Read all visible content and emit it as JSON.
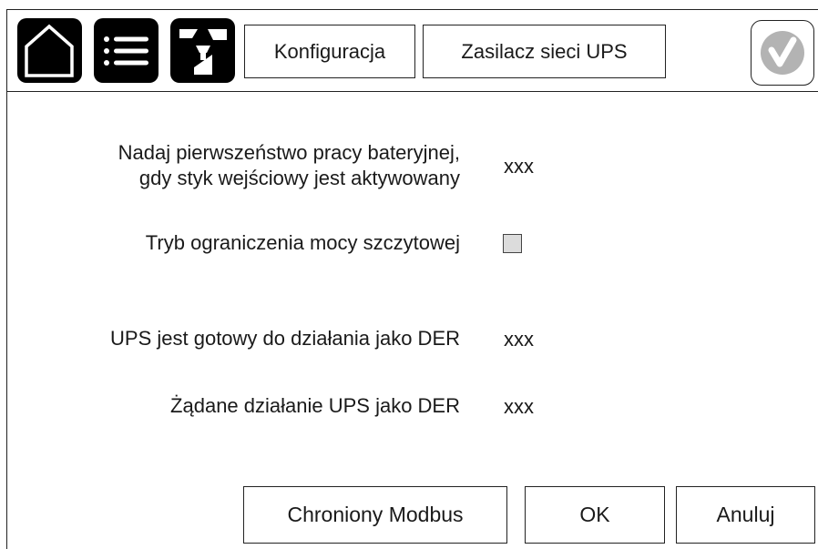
{
  "header": {
    "icons": [
      "home-icon",
      "menu-list-icon",
      "tools-icon"
    ],
    "tabs": [
      {
        "label": "Konfiguracja"
      },
      {
        "label": "Zasilacz sieci UPS"
      }
    ],
    "status_icon": "checkmark-icon"
  },
  "settings": {
    "rows": [
      {
        "label_line1": "Nadaj pierwszeństwo pracy bateryjnej,",
        "label_line2": "gdy styk wejściowy jest aktywowany",
        "value": "xxx"
      },
      {
        "label": "Tryb ograniczenia mocy szczytowej",
        "checked": false
      },
      {
        "label": "UPS jest gotowy do działania jako DER",
        "value": "xxx"
      },
      {
        "label": "Żądane działanie UPS jako DER",
        "value": "xxx"
      }
    ]
  },
  "footer": {
    "modbus_label": "Chroniony Modbus",
    "ok_label": "OK",
    "cancel_label": "Anuluj"
  },
  "colors": {
    "icon_bg": "#000000",
    "check_gray": "#b3b3b3",
    "checkbox_fill": "#dcdcdc"
  }
}
